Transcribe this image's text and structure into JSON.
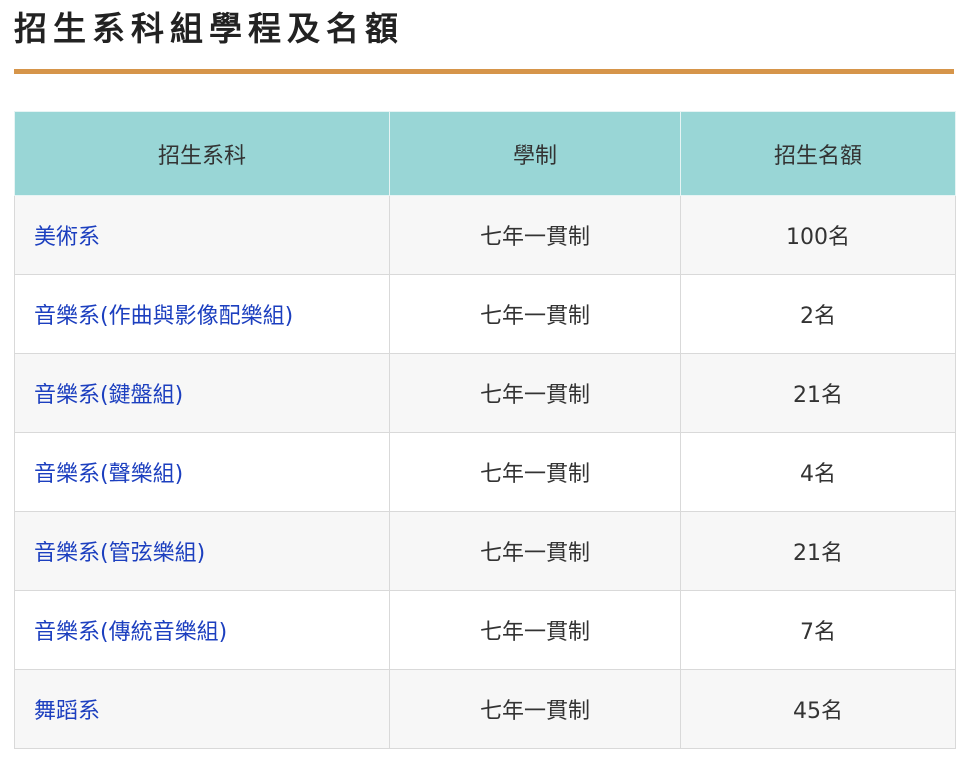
{
  "page": {
    "title": "招生系科組學程及名額"
  },
  "table": {
    "headers": [
      "招生系科",
      "學制",
      "招生名額"
    ],
    "rows": [
      {
        "dept": "美術系",
        "system": "七年一貫制",
        "quota": "100名"
      },
      {
        "dept": "音樂系(作曲與影像配樂組)",
        "system": "七年一貫制",
        "quota": "2名"
      },
      {
        "dept": "音樂系(鍵盤組)",
        "system": "七年一貫制",
        "quota": "21名"
      },
      {
        "dept": "音樂系(聲樂組)",
        "system": "七年一貫制",
        "quota": "4名"
      },
      {
        "dept": "音樂系(管弦樂組)",
        "system": "七年一貫制",
        "quota": "21名"
      },
      {
        "dept": "音樂系(傳統音樂組)",
        "system": "七年一貫制",
        "quota": "7名"
      },
      {
        "dept": "舞蹈系",
        "system": "七年一貫制",
        "quota": "45名"
      }
    ]
  },
  "colors": {
    "accent_rule": "#d6954a",
    "header_bg": "#99d6d6",
    "link": "#1c3fbf"
  }
}
